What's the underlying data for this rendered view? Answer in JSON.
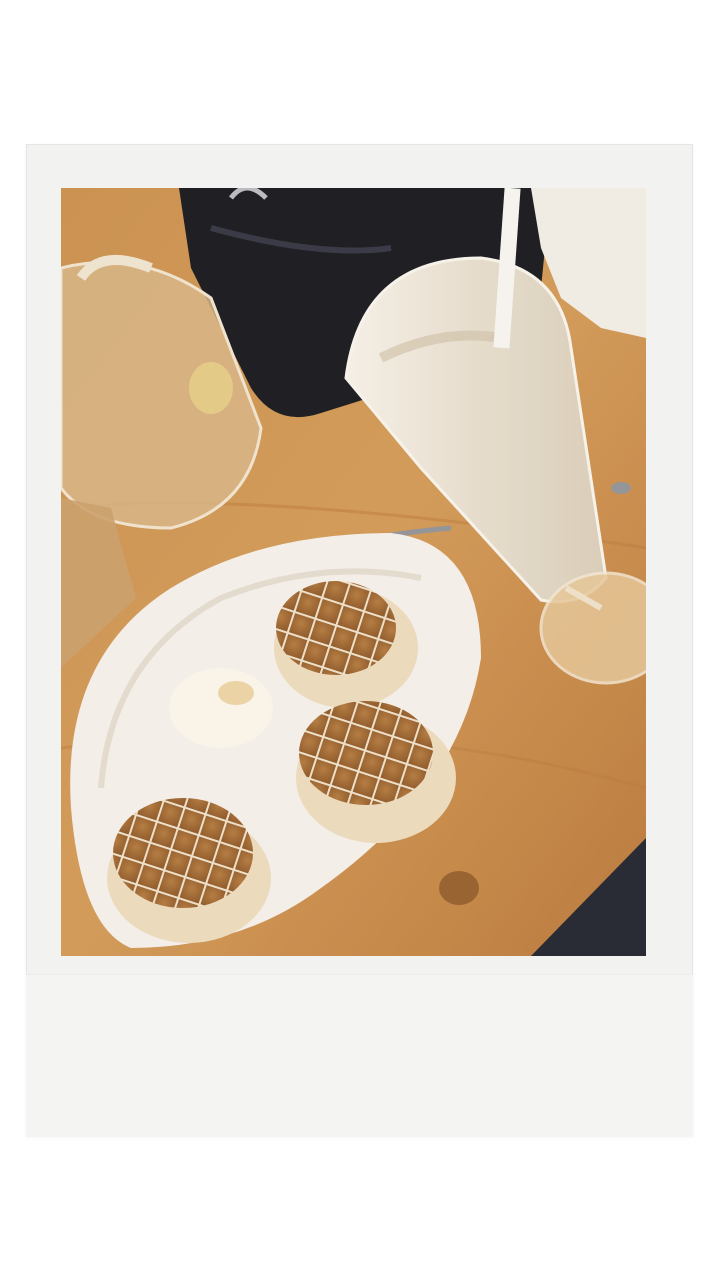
{
  "scene": {
    "photo_label": "instant-photo-of-cafe-table-with-dessert-and-milkshake"
  },
  "colors": {
    "frame": "#f2f2f0",
    "table_wood": "#c68a48",
    "plate": "#f4f2ee",
    "bag": "#15181f",
    "dessert_top": "#a8733e",
    "milkshake": "#e9e3d6"
  }
}
